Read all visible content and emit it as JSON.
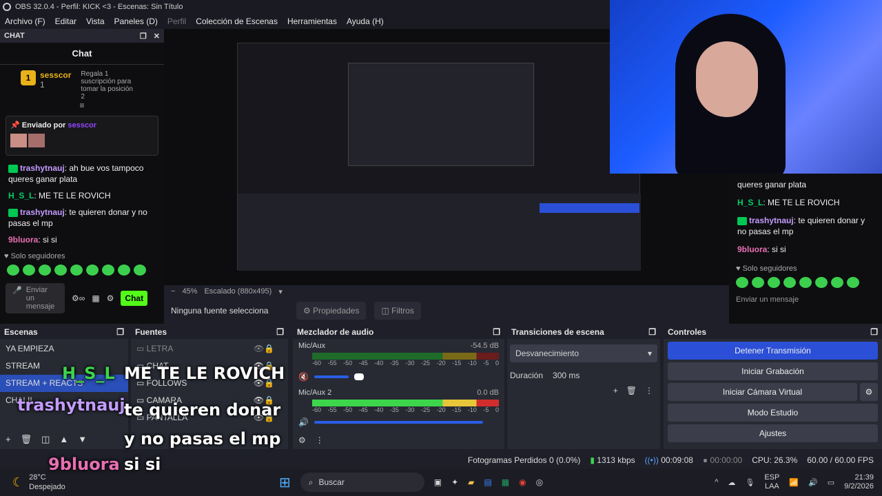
{
  "window": {
    "title": "OBS 32.0.4 - Perfil: KICK <3 - Escenas: Sin Título"
  },
  "menu": [
    "Archivo (F)",
    "Editar",
    "Vista",
    "Paneles (D)",
    "Perfil",
    "Colección de Escenas",
    "Herramientas",
    "Ayuda (H)"
  ],
  "chat": {
    "dock_title": "CHAT",
    "title": "Chat",
    "leader_name": "sesscor",
    "leader_count": "1",
    "gift_text": "Regala 1 suscripción para tomar la posición 2",
    "pinned_label": "Enviado por",
    "pinned_user": "sesscor",
    "messages": [
      {
        "user": "trashytnauj",
        "text": ": ah bue vos tampoco queres ganar plata"
      },
      {
        "user": "H_S_L",
        "text": ": ME TE LE ROVICH"
      },
      {
        "user": "trashytnauj",
        "text": ": te quieren donar y no pasas el mp"
      },
      {
        "user": "9bluora",
        "text": ": si si"
      }
    ],
    "followers_only": "Solo seguidores",
    "send_placeholder": "Enviar un mensaje",
    "chat_button": "Chat"
  },
  "right_chat": {
    "partial": "queres ganar plata",
    "messages": [
      {
        "user": "H_S_L",
        "text": ": ME TE LE ROVICH"
      },
      {
        "user": "trashytnauj",
        "text": ": te quieren donar y no pasas el mp"
      },
      {
        "user": "9bluora",
        "text": ": si si"
      }
    ],
    "followers_only": "Solo seguidores",
    "send_placeholder": "Enviar un mensaje"
  },
  "preview": {
    "zoom": "45%",
    "scale": "Escalado (880x495)",
    "no_source": "Ninguna fuente selecciona",
    "properties": "Propiedades",
    "filters": "Filtros"
  },
  "scenes": {
    "title": "Escenas",
    "items": [
      "YA EMPIEZA",
      "STREAM",
      "STREAM + REACTS",
      "CHAL!!"
    ],
    "selected": 2
  },
  "sources": {
    "title": "Fuentes",
    "items": [
      "LETRA",
      "CHAT",
      "FOLLOWS",
      "CAMARA",
      "PANTALLA"
    ]
  },
  "mixer": {
    "title": "Mezclador de audio",
    "channels": [
      {
        "name": "Mic/Aux",
        "db": "-54.5 dB",
        "level": 0.0,
        "muted": true
      },
      {
        "name": "Mic/Aux 2",
        "db": "0.0 dB",
        "level": 1.0,
        "muted": false
      }
    ],
    "ticks": [
      "-60",
      "-55",
      "-50",
      "-45",
      "-40",
      "-35",
      "-30",
      "-25",
      "-20",
      "-15",
      "-10",
      "-5",
      "0"
    ]
  },
  "transitions": {
    "title": "Transiciones de escena",
    "selected": "Desvanecimiento",
    "duration_label": "Duración",
    "duration": "300 ms"
  },
  "controls": {
    "title": "Controles",
    "buttons": [
      "Detener Transmisión",
      "Iniciar Grabación",
      "Iniciar Cámara Virtual",
      "Modo Estudio",
      "Ajustes"
    ]
  },
  "status": {
    "dropped": "Fotogramas Perdidos 0 (0.0%)",
    "bitrate": "1313 kbps",
    "stream_time": "00:09:08",
    "rec_time": "00:00:00",
    "cpu": "CPU: 26.3%",
    "fps": "60.00 / 60.00 FPS"
  },
  "overlay": {
    "lines": [
      {
        "user": "H_S_L",
        "text": "ME TE LE ROVICH"
      },
      {
        "user": "trashytnauj",
        "text": "te quieren donar y no pasas el mp"
      },
      {
        "user": "9bluora",
        "text": "si si"
      }
    ]
  },
  "taskbar": {
    "weather_temp": "28°C",
    "weather_desc": "Despejado",
    "search": "Buscar",
    "lang1": "ESP",
    "lang2": "LAA",
    "time": "21:39",
    "date": "9/2/2026"
  },
  "colors": {
    "accent": "#2b4fd6",
    "selected": "#2b4fb8",
    "kick_green": "#53fc18"
  }
}
